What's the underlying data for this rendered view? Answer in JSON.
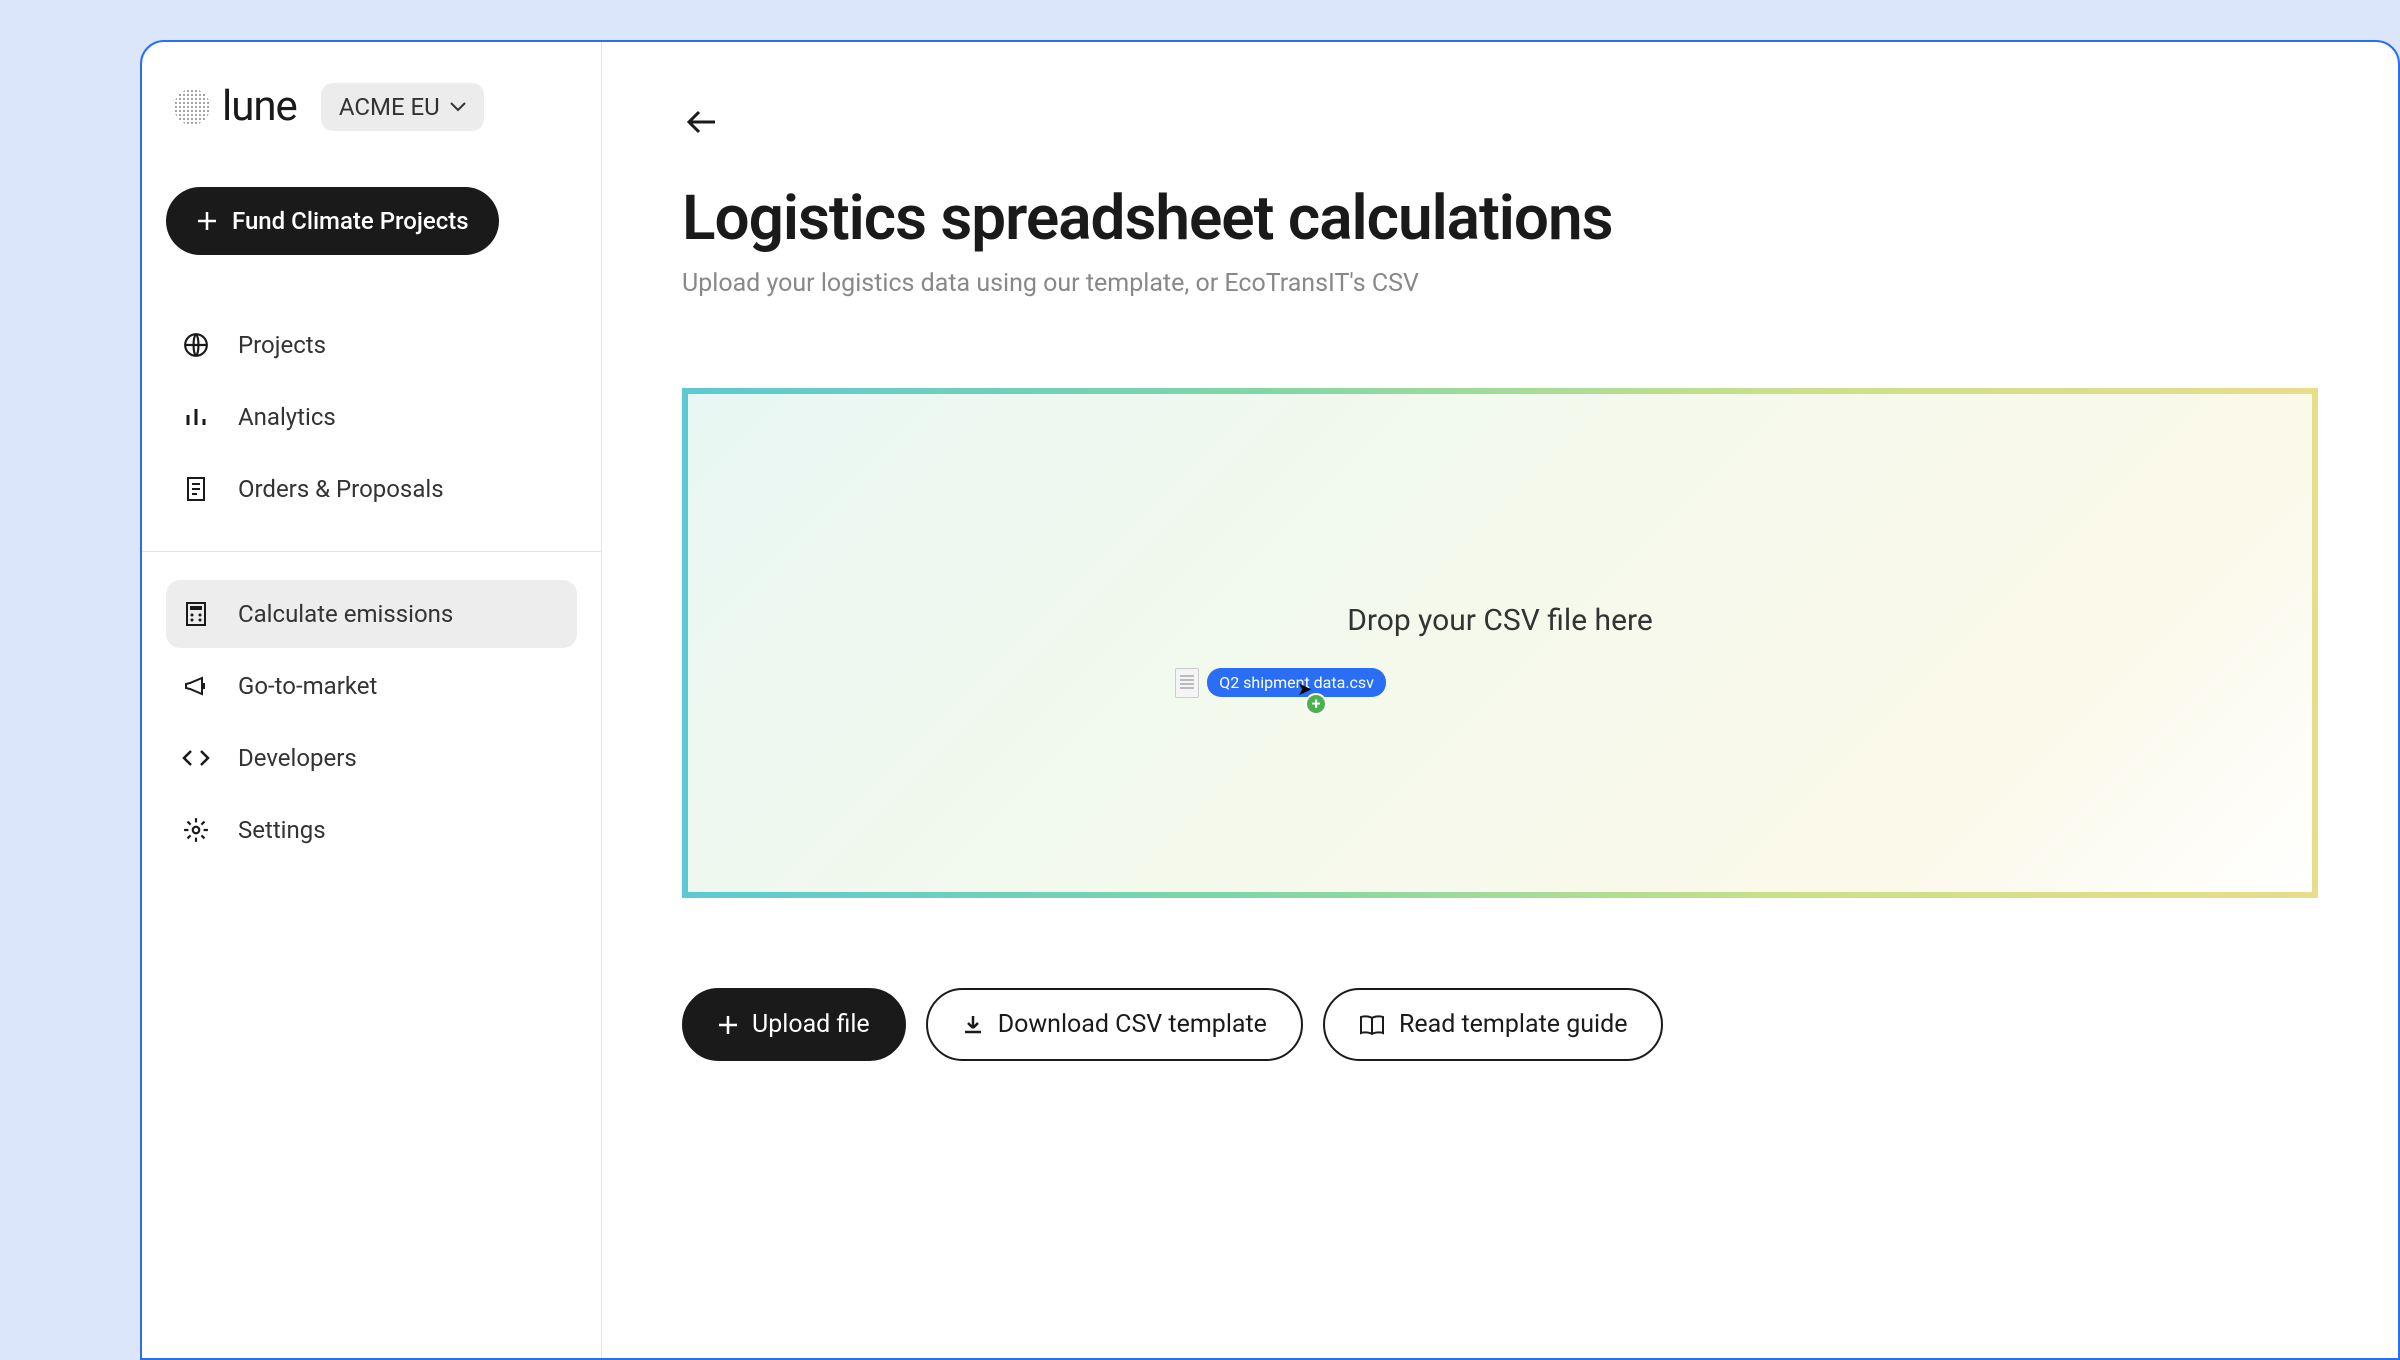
{
  "brand": "lune",
  "orgSelector": {
    "label": "ACME EU"
  },
  "primaryAction": {
    "label": "Fund Climate Projects"
  },
  "nav": {
    "group1": [
      {
        "label": "Projects"
      },
      {
        "label": "Analytics"
      },
      {
        "label": "Orders & Proposals"
      }
    ],
    "group2": [
      {
        "label": "Calculate emissions"
      },
      {
        "label": "Go-to-market"
      },
      {
        "label": "Developers"
      },
      {
        "label": "Settings"
      }
    ]
  },
  "page": {
    "title": "Logistics spreadsheet calculations",
    "subtitle": "Upload your logistics data using our template, or EcoTransIT's CSV"
  },
  "dropzone": {
    "prompt": "Drop your CSV file here",
    "draggedFile": "Q2 shipment data.csv"
  },
  "actions": {
    "upload": "Upload file",
    "download": "Download CSV template",
    "guide": "Read template guide"
  }
}
